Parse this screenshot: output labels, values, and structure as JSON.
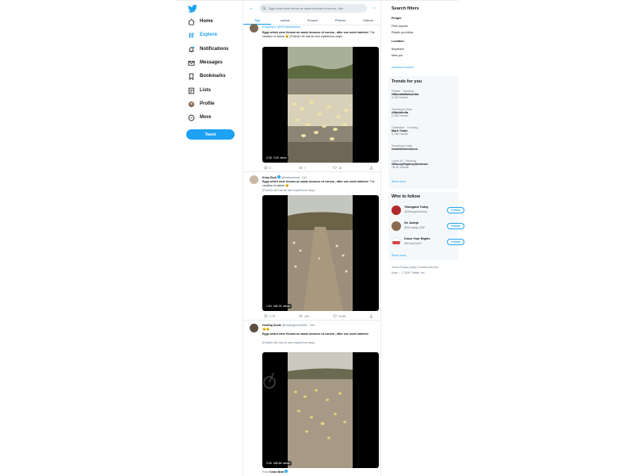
{
  "nav": {
    "items": [
      {
        "label": "Home",
        "icon": "home-icon"
      },
      {
        "label": "Explore",
        "icon": "hashtag-icon"
      },
      {
        "label": "Notifications",
        "icon": "bell-icon"
      },
      {
        "label": "Messages",
        "icon": "envelope-icon"
      },
      {
        "label": "Bookmarks",
        "icon": "bookmark-icon"
      },
      {
        "label": "Lists",
        "icon": "list-icon"
      },
      {
        "label": "Profile",
        "icon": "avatar-icon"
      },
      {
        "label": "More",
        "icon": "more-circle-icon"
      }
    ],
    "tweet_button": "Tweet"
  },
  "search": {
    "value": "Eggs which were thrown as waste because of corona , afte"
  },
  "tabs": [
    "Top",
    "Latest",
    "People",
    "Photos",
    "Videos"
  ],
  "tweets": [
    {
      "header": "Replying to @DrSubramanian",
      "text_bold": "Eggs which were thrown as waste because of corona , after one week hatched",
      "text_rest": ". The creation of nature 😮 (Foded) Life has its own mysterious ways...",
      "video_time": "0:36",
      "video_views": "3.4K views",
      "actions": {
        "reply": "9",
        "retweet": "7",
        "like": "16"
      }
    },
    {
      "name": "Kiran Bedi",
      "handle": "@thekiranbedi · 21h",
      "text_bold": "Eggs which were thrown as waste because of corona , after one week hatched",
      "text_rest": ". The creation of nature 😮",
      "sub": "(Foded) Life has its own mysterious ways...",
      "video_time": "1:54",
      "video_views": "466.7K views",
      "actions": {
        "reply": "2.7K",
        "retweet": "44K",
        "like": "15.5K"
      }
    },
    {
      "name": "Healing Souls",
      "handle": "@healingsouls1606 · 16h",
      "emoji": "😮😮",
      "text_bold": "Eggs which were thrown as waste because of corona , after one week hatched",
      "sub": "(Foded) Life has its own mysterious ways.",
      "video_time": "2:05",
      "video_views": "465.8K views",
      "from_label": "From",
      "from_name": "Kiran Bedi"
    }
  ],
  "search_filters": {
    "title": "Search filters",
    "people_label": "People",
    "people_options": [
      "From anyone",
      "People you follow"
    ],
    "location_label": "Location",
    "location_options": [
      "Anywhere",
      "Near you"
    ],
    "advanced": "Advanced search"
  },
  "trends": {
    "title": "Trends for you",
    "items": [
      {
        "context": "Politics · Trending",
        "name": "#MamataBalsamba",
        "count": "3,440 Tweets"
      },
      {
        "context": "Trending in India",
        "name": "#WashIndia",
        "count": "2,336 Tweets"
      },
      {
        "context": "Celebrities · Trending",
        "name": "Mark Twain",
        "count": "5,789 Tweets"
      },
      {
        "context": "Trending in India",
        "name": "#cabinetdecisions",
        "count": ""
      },
      {
        "context": "Covid-19 · Trending",
        "name": "#BloodyRajdeepSardesai",
        "count": "7B.4K Tweets"
      }
    ],
    "show_more": "Show more"
  },
  "who_to_follow": {
    "title": "Who to follow",
    "items": [
      {
        "name": "Telangana Today",
        "handle": "@TelanganaToday",
        "button": "Follow",
        "avatar_color": "#b02a2a"
      },
      {
        "name": "Sir Jadeja",
        "handle": "@SirJadeja_BJP",
        "button": "Follow",
        "avatar_color": "#8a6a50"
      },
      {
        "name": "Know Your Rights",
        "handle": "@KnowYourR",
        "button": "Follow",
        "avatar_color": "#d64545"
      }
    ],
    "show_more": "Show more"
  },
  "footer": {
    "line1": "Terms  Privacy policy  Cookies  Ads info",
    "line2": "More ⌄  © 2020 Twitter, Inc."
  },
  "colors": {
    "accent": "#1da1f2",
    "border": "#e6ecf0",
    "muted": "#657786"
  }
}
